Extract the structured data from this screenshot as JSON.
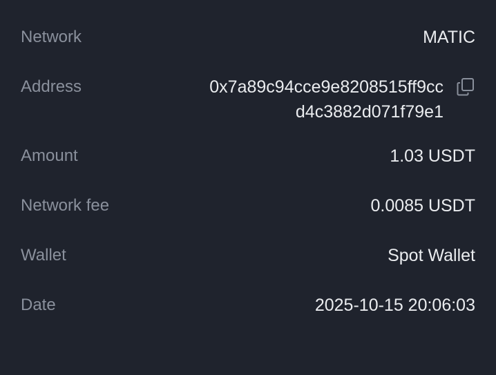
{
  "rows": {
    "network": {
      "label": "Network",
      "value": "MATIC"
    },
    "address": {
      "label": "Address",
      "line1": "0x7a89c94cce9e8208515ff9cc",
      "line2": "d4c3882d071f79e1",
      "copy_icon": "copy-icon"
    },
    "amount": {
      "label": "Amount",
      "value": "1.03 USDT"
    },
    "network_fee": {
      "label": "Network fee",
      "value": "0.0085 USDT"
    },
    "wallet": {
      "label": "Wallet",
      "value": "Spot Wallet"
    },
    "date": {
      "label": "Date",
      "value": "2025-10-15 20:06:03"
    }
  },
  "colors": {
    "background": "#1f232d",
    "label": "#8a909c",
    "value": "#eaecef"
  }
}
